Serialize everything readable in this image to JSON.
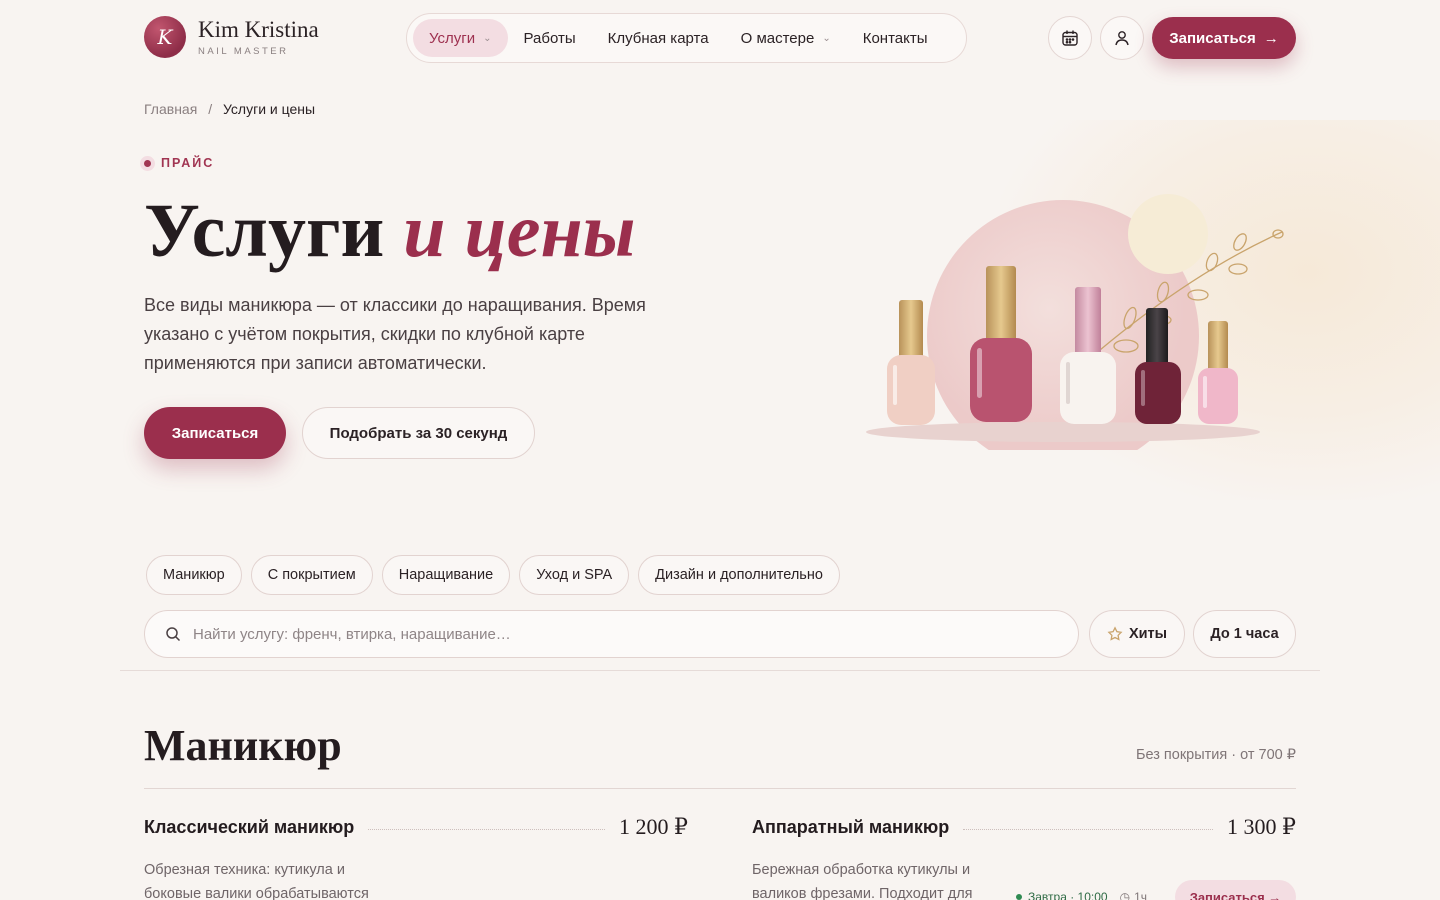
{
  "brand": {
    "initial": "K",
    "name": "Kim Kristina",
    "subtitle": "NAIL MASTER"
  },
  "nav": {
    "items": [
      {
        "label": "Услуги",
        "active": true,
        "has_dropdown": true
      },
      {
        "label": "Работы",
        "active": false,
        "has_dropdown": false
      },
      {
        "label": "Клубная карта",
        "active": false,
        "has_dropdown": false
      },
      {
        "label": "О мастере",
        "active": false,
        "has_dropdown": true
      },
      {
        "label": "Контакты",
        "active": false,
        "has_dropdown": false
      }
    ]
  },
  "header": {
    "calendar_icon": "calendar-icon",
    "user_icon": "user-icon",
    "cta_label": "Записаться",
    "cta_arrow": "→"
  },
  "breadcrumb": {
    "home": "Главная",
    "separator": "/",
    "current": "Услуги и цены"
  },
  "hero": {
    "eyebrow": "ПРАЙС",
    "title_plain": "Услуги",
    "title_accent": "и цены",
    "lead": "Все виды маникюра — от классики до наращивания. Время указано с учётом покрытия, скидки по клубной карте применяются при записи автоматически.",
    "primary_button": "Записаться",
    "secondary_button": "Подобрать за 30 секунд"
  },
  "filters": {
    "categories": [
      "Маникюр",
      "С покрытием",
      "Наращивание",
      "Уход и SPA",
      "Дизайн и дополнительно"
    ],
    "search_placeholder": "Найти услугу: френч, втирка, наращивание…",
    "search_value": "",
    "hits_label": "Хиты",
    "duration_label": "До 1 часа"
  },
  "section": {
    "title": "Маникюр",
    "note": "Без покрытия · от 700 ₽",
    "services": [
      {
        "name": "Классический маникюр",
        "price": "1 200 ₽",
        "description": "Обрезная техника: кутикула и боковые валики обрабатываются"
      },
      {
        "name": "Аппаратный маникюр",
        "price": "1 300 ₽",
        "description": "Бережная обработка кутикулы и валиков фрезами. Подходит для"
      }
    ],
    "slot": {
      "label": "Завтра · 10:00",
      "duration": "1ч"
    },
    "slot_button": "Записаться →"
  },
  "colors": {
    "accent": "#9b2f4d",
    "accent_soft": "#f3dde2",
    "background": "#f8f4f1",
    "text": "#2b2225"
  }
}
